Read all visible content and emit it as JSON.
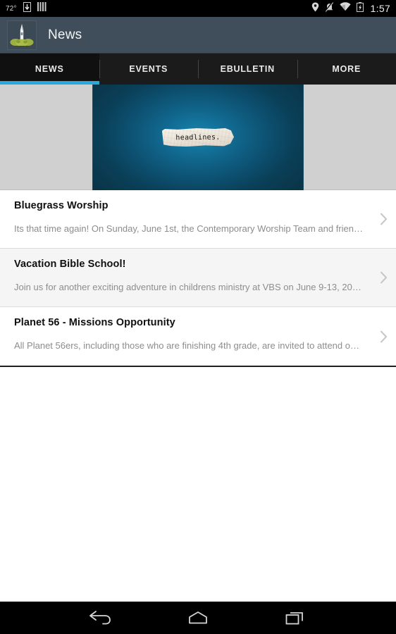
{
  "status_bar": {
    "temperature": "72°",
    "clock": "1:57",
    "left_icons": [
      "download-icon",
      "signal-bars-icon"
    ],
    "right_icons": [
      "location-pin-icon",
      "ringer-muted-icon",
      "wifi-icon",
      "battery-charging-icon"
    ]
  },
  "app_bar": {
    "title": "News",
    "logo": "church-steeple-logo"
  },
  "tabs": {
    "items": [
      {
        "label": "NEWS",
        "active": true
      },
      {
        "label": "EVENTS",
        "active": false
      },
      {
        "label": "EBULLETIN",
        "active": false
      },
      {
        "label": "MORE",
        "active": false
      }
    ],
    "indicator_color": "#29a8dc"
  },
  "banner": {
    "name": "headlines-banner",
    "paper_text": "headlines.",
    "background_color": "#0d5273",
    "side_color": "#d0d0d0"
  },
  "news": {
    "items": [
      {
        "title": "Bluegrass Worship",
        "excerpt": "Its that time again! On Sunday, June 1st, the Contemporary Worship Team and frien…"
      },
      {
        "title": "Vacation Bible School!",
        "excerpt": "Join us for another exciting adventure in childrens ministry at VBS on June 9-13, 20…"
      },
      {
        "title": "Planet 56 - Missions Opportunity",
        "excerpt": "All Planet 56ers, including those who are finishing 4th grade, are invited to attend o…"
      }
    ]
  },
  "nav_bar": {
    "buttons": [
      "back-button",
      "home-button",
      "recents-button"
    ]
  }
}
